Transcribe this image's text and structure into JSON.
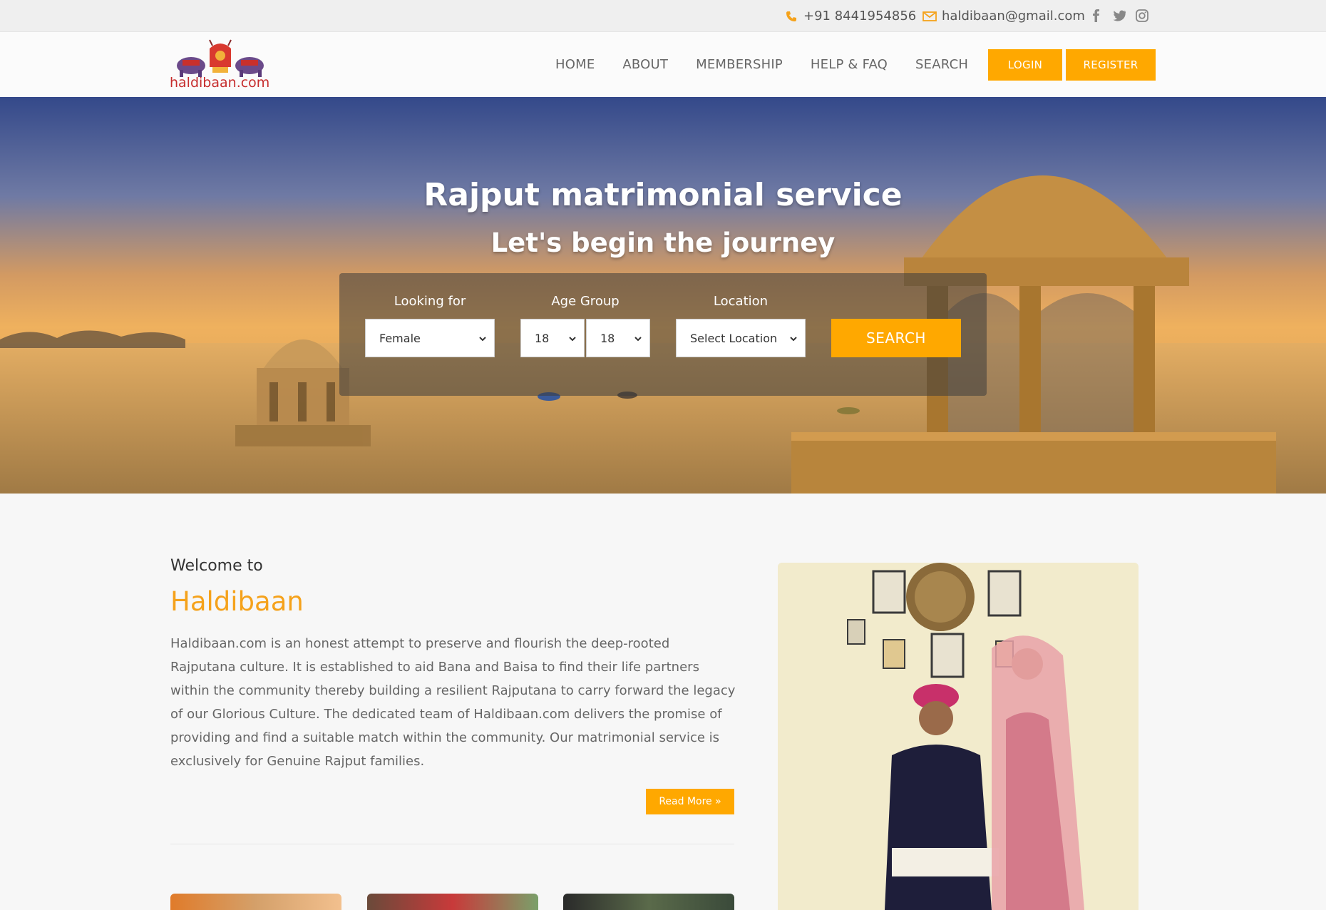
{
  "topbar": {
    "phone": "+91 8441954856",
    "email": "haldibaan@gmail.com",
    "social": [
      "facebook-icon",
      "twitter-icon",
      "instagram-icon"
    ]
  },
  "header": {
    "logo_text": "haldibaan.com",
    "nav": [
      "HOME",
      "ABOUT",
      "MEMBERSHIP",
      "HELP & FAQ",
      "SEARCH"
    ],
    "login_label": "LOGIN",
    "register_label": "REGISTER"
  },
  "hero": {
    "title": "Rajput matrimonial service",
    "subtitle": "Let's begin the journey",
    "search": {
      "looking_for_label": "Looking for",
      "looking_for_value": "Female",
      "age_group_label": "Age Group",
      "age_from_value": "18",
      "age_to_value": "18",
      "location_label": "Location",
      "location_value": "Select Location",
      "button_label": "SEARCH"
    }
  },
  "about": {
    "welcome": "Welcome to",
    "heading": "Haldibaan",
    "paragraph": "Haldibaan.com is an honest attempt to preserve and flourish the deep-rooted Rajputana culture. It is established to aid Bana and Baisa to find their life partners within the community thereby building a resilient Rajputana to carry forward the legacy of our Glorious Culture. The dedicated team of Haldibaan.com delivers the promise of providing and find a suitable match within the community. Our matrimonial service is exclusively for Genuine Rajput families.",
    "read_more": "Read More »"
  },
  "colors": {
    "accent": "#ffa800",
    "heading_orange": "#f5a21b"
  }
}
